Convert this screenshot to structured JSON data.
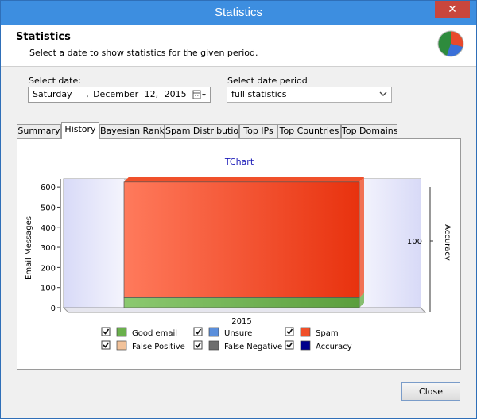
{
  "window": {
    "title": "Statistics",
    "close_glyph": "✕"
  },
  "header": {
    "title": "Statistics",
    "subtitle": "Select a date to show statistics for the given period."
  },
  "date": {
    "label": "Select date:",
    "weekday": "Saturday",
    "sep": ",",
    "month": "December",
    "day": "12,",
    "year": "2015"
  },
  "period": {
    "label": "Select date period",
    "value": "full statistics"
  },
  "tabs": [
    "Summary",
    "History",
    "Bayesian Rank",
    "Spam Distribution",
    "Top IPs",
    "Top Countries",
    "Top Domains"
  ],
  "active_tab": "History",
  "chart_data": {
    "type": "bar",
    "title": "TChart",
    "ylabel": "Email Messages",
    "y2label": "Accuracy",
    "y2_ticks": [
      "100"
    ],
    "categories": [
      "2015"
    ],
    "ylim": [
      0,
      640
    ],
    "yticks": [
      "600",
      "500",
      "400",
      "300",
      "200",
      "100",
      "0"
    ],
    "stacked": true,
    "series": [
      {
        "name": "Good email",
        "values": [
          50
        ],
        "color": "#6ab04c"
      },
      {
        "name": "Spam",
        "values": [
          575
        ],
        "color": "#f0502a"
      }
    ],
    "legend": [
      {
        "name": "Good email",
        "color": "#6ab04c",
        "checked": true
      },
      {
        "name": "Unsure",
        "color": "#5b8fdc",
        "checked": true
      },
      {
        "name": "Spam",
        "color": "#f0502a",
        "checked": true
      },
      {
        "name": "False Positive",
        "color": "#f2c29a",
        "checked": true
      },
      {
        "name": "False Negative",
        "color": "#6e6e6e",
        "checked": true
      },
      {
        "name": "Accuracy",
        "color": "#00008b",
        "checked": true
      }
    ],
    "legend_position": "bottom",
    "grid": false
  },
  "buttons": {
    "close": "Close"
  }
}
